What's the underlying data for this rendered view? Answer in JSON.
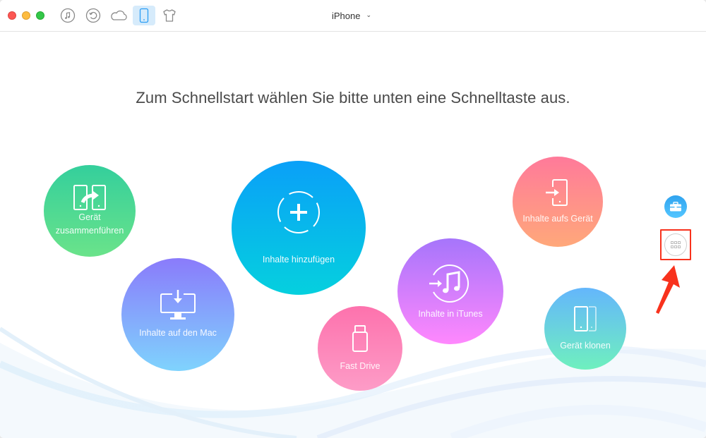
{
  "window": {
    "title_device": "iPhone",
    "traffic_lights": [
      "close",
      "minimize",
      "maximize"
    ]
  },
  "toolbar": {
    "buttons": [
      {
        "icon": "music-icon",
        "label": "Audio",
        "active": false
      },
      {
        "icon": "restore-icon",
        "label": "Backup",
        "active": false
      },
      {
        "icon": "cloud-icon",
        "label": "iCloud",
        "active": false
      },
      {
        "icon": "iphone-icon",
        "label": "Device",
        "active": true
      },
      {
        "icon": "shirt-icon",
        "label": "Theme",
        "active": false
      }
    ],
    "device_chevron": "⌄"
  },
  "main": {
    "headline": "Zum Schnellstart wählen Sie bitte unten eine Schnelltaste aus.",
    "shortcuts": [
      {
        "id": "merge",
        "label_line1": "Gerät",
        "label_line2": "zusammenführen",
        "icon": "merge-devices-icon",
        "color_top": "#34cf9c",
        "color_bottom": "#6ae38a"
      },
      {
        "id": "add",
        "label": "Inhalte hinzufügen",
        "icon": "add-content-icon",
        "color_top": "#0aa0f8",
        "color_bottom": "#05d0de"
      },
      {
        "id": "to-mac",
        "label": "Inhalte auf den Mac",
        "icon": "download-to-mac-icon",
        "color_top": "#8a7bfb",
        "color_bottom": "#7fd3fd"
      },
      {
        "id": "fast-drive",
        "label": "Fast Drive",
        "icon": "usb-drive-icon",
        "color_top": "#fd72ad",
        "color_bottom": "#fd9cc7"
      },
      {
        "id": "to-itunes",
        "label": "Inhalte in iTunes",
        "icon": "itunes-transfer-icon",
        "color_top": "#a675fb",
        "color_bottom": "#ff88fd"
      },
      {
        "id": "to-device",
        "label": "Inhalte aufs Gerät",
        "icon": "to-device-icon",
        "color_top": "#ff7a9a",
        "color_bottom": "#ffa87a"
      },
      {
        "id": "clone",
        "label": "Gerät klonen",
        "icon": "clone-device-icon",
        "color_top": "#64b6fc",
        "color_bottom": "#6ff0be"
      }
    ]
  },
  "side": {
    "toolbox_icon": "toolbox-icon",
    "more_icon": "grid-icon",
    "highlight_color": "#f8321d"
  }
}
